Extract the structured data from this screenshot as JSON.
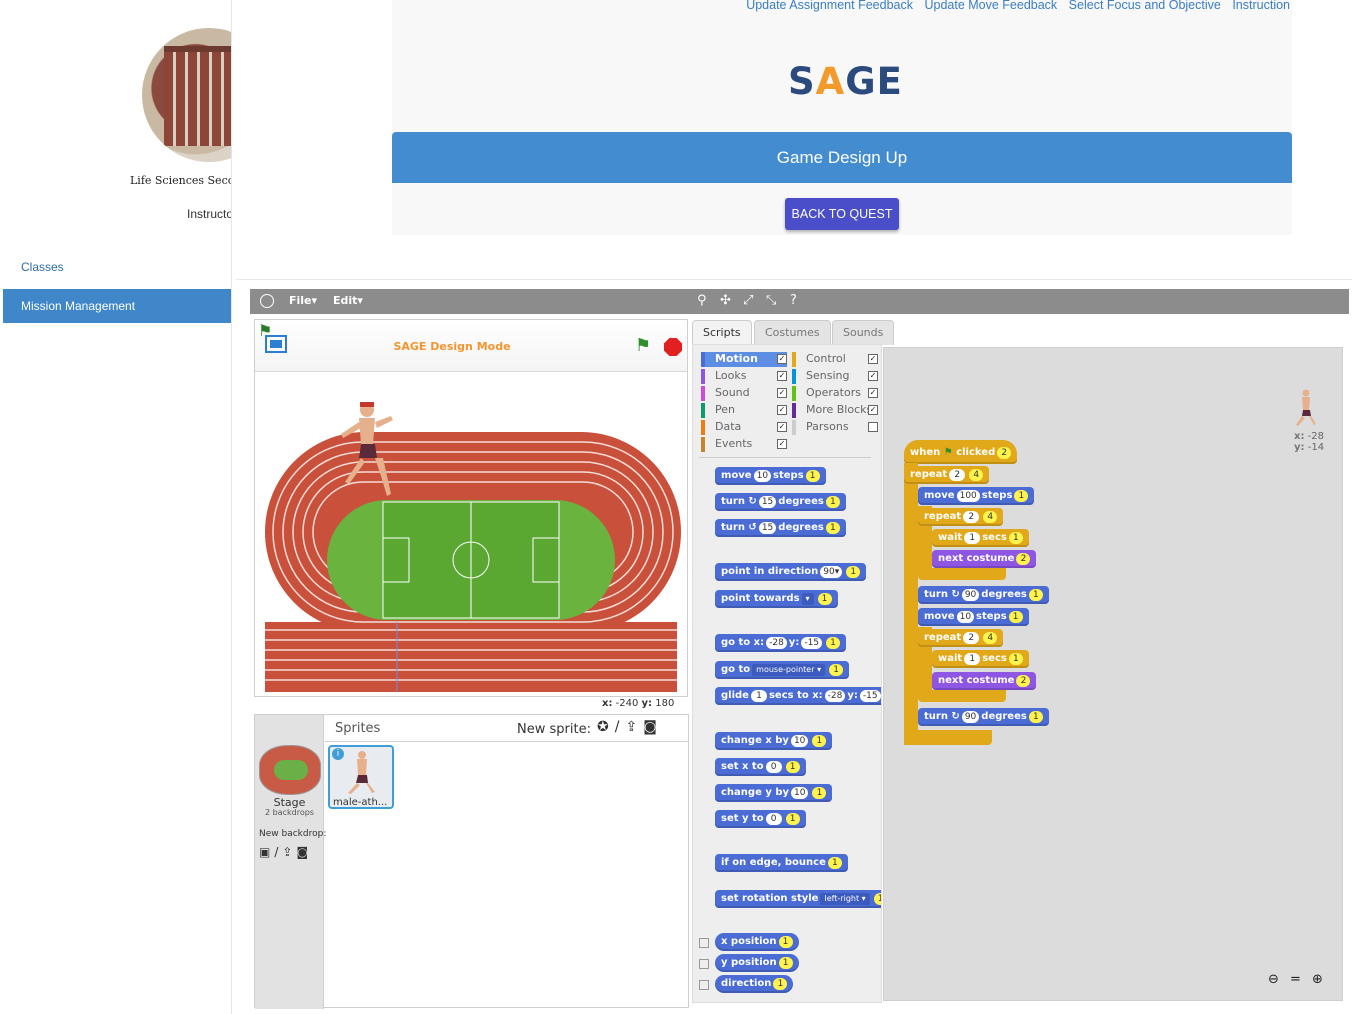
{
  "sidebar": {
    "logo_text": "Life Sciences Secon",
    "instructor": "Instructo",
    "items": [
      {
        "label": "Classes"
      },
      {
        "label": "Mission Management"
      }
    ]
  },
  "header": {
    "links": [
      "Update Assignment Feedback",
      "Update Move Feedback",
      "Select Focus and Objective",
      "Instruction"
    ],
    "brand_left": "S",
    "brand_a": "A",
    "brand_right": "GE",
    "banner_title": "Game Design Up",
    "back_button": "BACK TO QUEST"
  },
  "snap": {
    "menu": {
      "file": "File▾",
      "edit": "Edit▾"
    },
    "stage_title": "SAGE Design Mode",
    "coords": {
      "x_label": "x:",
      "x": "-240",
      "y_label": "y:",
      "y": "180"
    },
    "corral": {
      "title": "Sprites",
      "new_sprite": "New sprite:",
      "stage_label": "Stage",
      "stage_sub": "2 backdrops",
      "new_backdrop": "New backdrop:",
      "sprite_name": "male-ath..."
    },
    "tabs": [
      "Scripts",
      "Costumes",
      "Sounds"
    ],
    "categories_left": [
      {
        "label": "Motion",
        "color": "#4a6cd4"
      },
      {
        "label": "Looks",
        "color": "#8f56e3"
      },
      {
        "label": "Sound",
        "color": "#cf4ad9"
      },
      {
        "label": "Pen",
        "color": "#0e9a6c"
      },
      {
        "label": "Data",
        "color": "#ee7d16"
      },
      {
        "label": "Events",
        "color": "#c88330"
      }
    ],
    "categories_right": [
      {
        "label": "Control",
        "color": "#e1a91a"
      },
      {
        "label": "Sensing",
        "color": "#0494dc"
      },
      {
        "label": "Operators",
        "color": "#62c213"
      },
      {
        "label": "More Blocks",
        "color": "#632d99"
      },
      {
        "label": "Parsons",
        "color": "#cccccc"
      }
    ],
    "palette_blocks": {
      "move": "move",
      "steps": "steps",
      "move_n": "10",
      "turn": "turn",
      "degrees": "degrees",
      "turn_n": "15",
      "point_dir": "point in direction",
      "dir_n": "90▾",
      "point_towards": "point towards",
      "goto_xy": "go to x:",
      "y": "y:",
      "gx": "-28",
      "gy": "-15",
      "goto": "go to",
      "mouse": "mouse-pointer ▾",
      "glide": "glide",
      "secs_to_x": "secs to x:",
      "glide_n": "1",
      "change_x": "change x by",
      "set_x": "set x to",
      "change_y": "change y by",
      "set_y": "set y to",
      "ten": "10",
      "zero": "0",
      "one": "1",
      "bounce": "if on edge, bounce",
      "rotation": "set rotation style",
      "left_right": "left-right ▾",
      "x_pos": "x position",
      "y_pos": "y position",
      "direction": "direction"
    },
    "script": {
      "when": "when",
      "clicked": "clicked",
      "repeat": "repeat",
      "wait": "wait",
      "secs": "secs",
      "next_costume": "next costume",
      "move": "move",
      "steps": "steps",
      "turn": "turn",
      "degrees": "degrees",
      "two": "2",
      "four": "4",
      "one": "1",
      "hundred": "100",
      "ninety": "90",
      "ten": "10"
    },
    "sprite_xy": {
      "x_label": "x:",
      "x": "-28",
      "y_label": "y:",
      "y": "-14"
    }
  }
}
